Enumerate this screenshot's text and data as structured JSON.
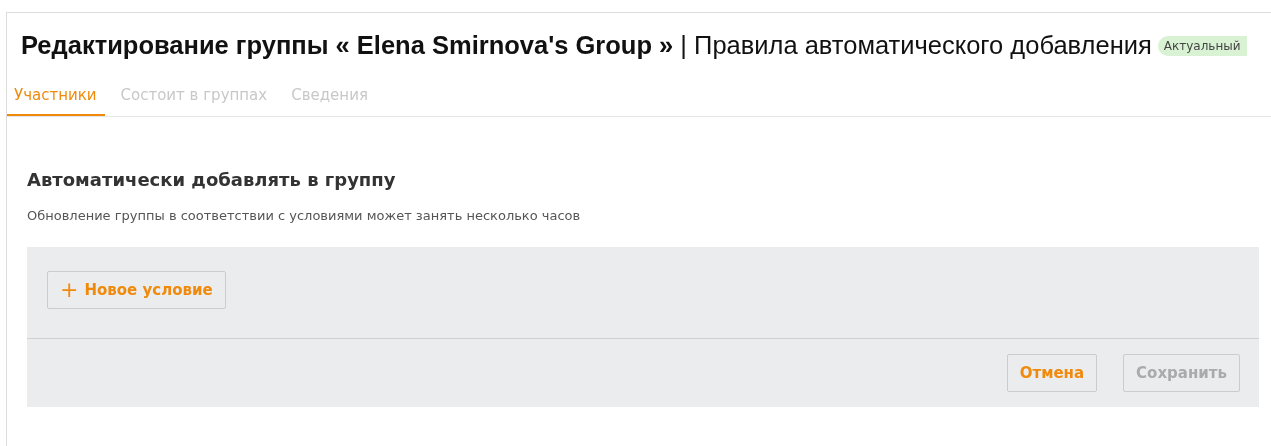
{
  "header": {
    "title": "**Редактирование группы « Elena Smirnova's Group »** | Правила автоматического добавления",
    "status_badge": "Актуальный"
  },
  "tabs": [
    {
      "label": "Участники",
      "selected": true
    },
    {
      "label": "Состоит в группах",
      "selected": false
    },
    {
      "label": "Сведения",
      "selected": false
    }
  ],
  "section": {
    "heading": "Автоматически добавлять в группу",
    "description": "Обновление группы в соответствии с условиями может занять несколько часов"
  },
  "conditions_panel": {
    "add_button": {
      "icon": "+",
      "label": "Новое условие"
    }
  },
  "footer_buttons": [
    {
      "label": "Отмена",
      "disabled": false
    },
    {
      "label": "Сохранить",
      "disabled": true
    }
  ]
}
